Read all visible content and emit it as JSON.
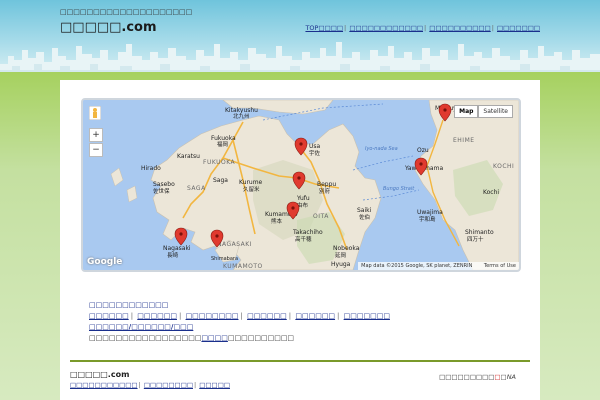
{
  "header": {
    "tagline": "□□□□□□□□□□□□□□□□□□□□",
    "title": "□□□□□.com",
    "nav": [
      "TOP□□□□",
      "□□□□□□□□□□□□",
      "□□□□□□□□□□",
      "□□□□□□□"
    ]
  },
  "map": {
    "maptype_map": "Map",
    "maptype_satellite": "Satellite",
    "attribution": "Map data ©2015 Google, SK planet, ZENRIN",
    "terms": "Terms of Use",
    "google": "Google",
    "zoom_in": "+",
    "zoom_out": "−",
    "places": [
      {
        "name": "Kitakyushu",
        "sub": "北九州"
      },
      {
        "name": "Fukuoka",
        "sub": "福岡"
      },
      {
        "name": "Karatsu"
      },
      {
        "name": "Hirado"
      },
      {
        "name": "Sasebo",
        "sub": "佐世保"
      },
      {
        "name": "Saga"
      },
      {
        "name": "Kurume",
        "sub": "久留米"
      },
      {
        "name": "Kumamoto",
        "sub": "熊本"
      },
      {
        "name": "Nagasaki",
        "sub": "長崎"
      },
      {
        "name": "Shimabara"
      },
      {
        "name": "Usa",
        "sub": "宇佐"
      },
      {
        "name": "Beppu",
        "sub": "別府"
      },
      {
        "name": "Yufu",
        "sub": "由布"
      },
      {
        "name": "Saiki",
        "sub": "佐伯"
      },
      {
        "name": "Takachiho",
        "sub": "高千穂"
      },
      {
        "name": "Nobeoka",
        "sub": "延岡"
      },
      {
        "name": "Hyuga",
        "sub": "日向"
      },
      {
        "name": "Matsuyama"
      },
      {
        "name": "Ozu"
      },
      {
        "name": "Yawatahama"
      },
      {
        "name": "Uwajima",
        "sub": "宇和島"
      },
      {
        "name": "Shimanto",
        "sub": "四万十"
      },
      {
        "name": "Kochi"
      }
    ],
    "regions": [
      "FUKUOKA",
      "SAGA",
      "NAGASAKI",
      "KUMAMOTO",
      "OITA",
      "EHIME",
      "KOCHI"
    ],
    "water": "Iyo-nada Sea",
    "water2": "Bungo Strait"
  },
  "links": {
    "heading": "□□□□□□□□□□□□",
    "row1": [
      "□□□□□□",
      "□□□□□□",
      "□□□□□□□□",
      "□□□□□□",
      "□□□□□□",
      "□□□□□□□"
    ],
    "row2": "□□□□□□/□□□□□□/□□□",
    "row3_pre": "□□□□□□□□□□□□□□□□□",
    "row3_link": "□□□□",
    "row3_post": "□□□□□□□□□□"
  },
  "footer": {
    "title": "□□□□□.com",
    "links": [
      "□□□□□□□□□□□",
      "□□□□□□□□",
      "□□□□□"
    ],
    "right_text": "□□□□□□□□□",
    "right_logo": "□",
    "right_na": "□NA"
  }
}
